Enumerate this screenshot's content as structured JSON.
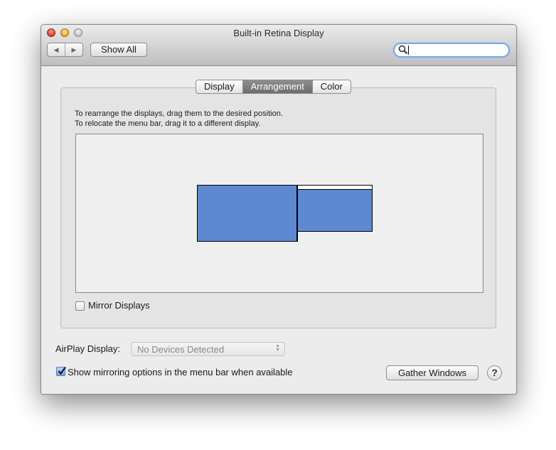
{
  "window": {
    "title": "Built-in Retina Display"
  },
  "toolbar": {
    "back_glyph": "◀",
    "forward_glyph": "▶",
    "show_all_label": "Show All",
    "search_value": ""
  },
  "tabs": [
    {
      "label": "Display",
      "selected": false
    },
    {
      "label": "Arrangement",
      "selected": true
    },
    {
      "label": "Color",
      "selected": false
    }
  ],
  "arrangement": {
    "instruction_line1": "To rearrange the displays, drag them to the desired position.",
    "instruction_line2": "To relocate the menu bar, drag it to a different display.",
    "display_color": "#5d89d0",
    "mirror_label": "Mirror Displays",
    "mirror_checked": false
  },
  "airplay": {
    "label": "AirPlay Display:",
    "selected_value": "No Devices Detected"
  },
  "show_mirroring": {
    "label": "Show mirroring options in the menu bar when available",
    "checked": true
  },
  "gather_windows_label": "Gather Windows",
  "help_label": "?"
}
